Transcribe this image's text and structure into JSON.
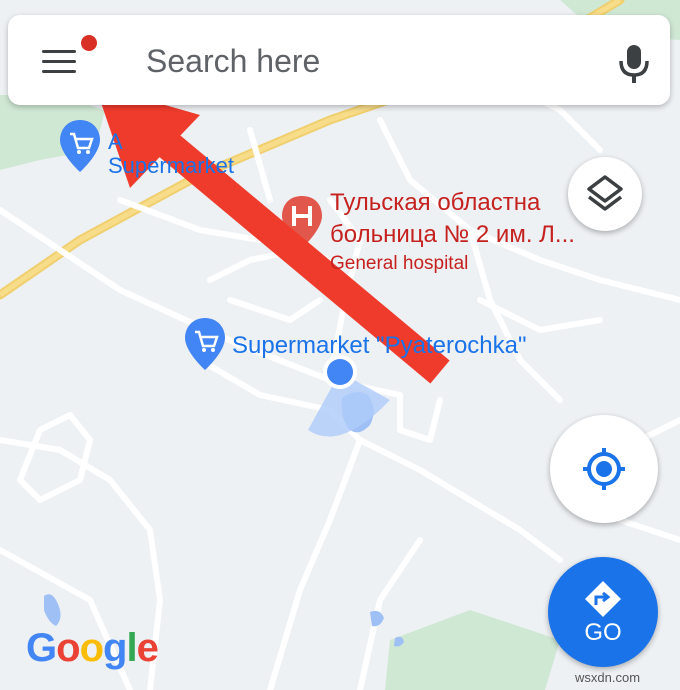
{
  "search": {
    "placeholder": "Search here"
  },
  "map": {
    "poi_top_left": {
      "label_line1": "А",
      "label_line2": "Supermarket",
      "icon": "cart-icon"
    },
    "hospital": {
      "label_line1": "Тульская областна",
      "label_line2": "больница № 2 им. Л...",
      "category": "General hospital",
      "icon": "hospital-h-icon"
    },
    "supermarket": {
      "label": "Supermarket \"Pyaterochka\"",
      "icon": "cart-icon"
    }
  },
  "buttons": {
    "go_label": "GO"
  },
  "branding": {
    "logo": "Google",
    "watermark": "wsxdn.com"
  },
  "colors": {
    "poi_blue": "#1a73e8",
    "hospital_red": "#d93025",
    "arrow_red": "#ef3b2c",
    "road_yellow": "#f5c84c",
    "park_green": "#cfe8d4",
    "water_blue": "#9ec0f5"
  }
}
